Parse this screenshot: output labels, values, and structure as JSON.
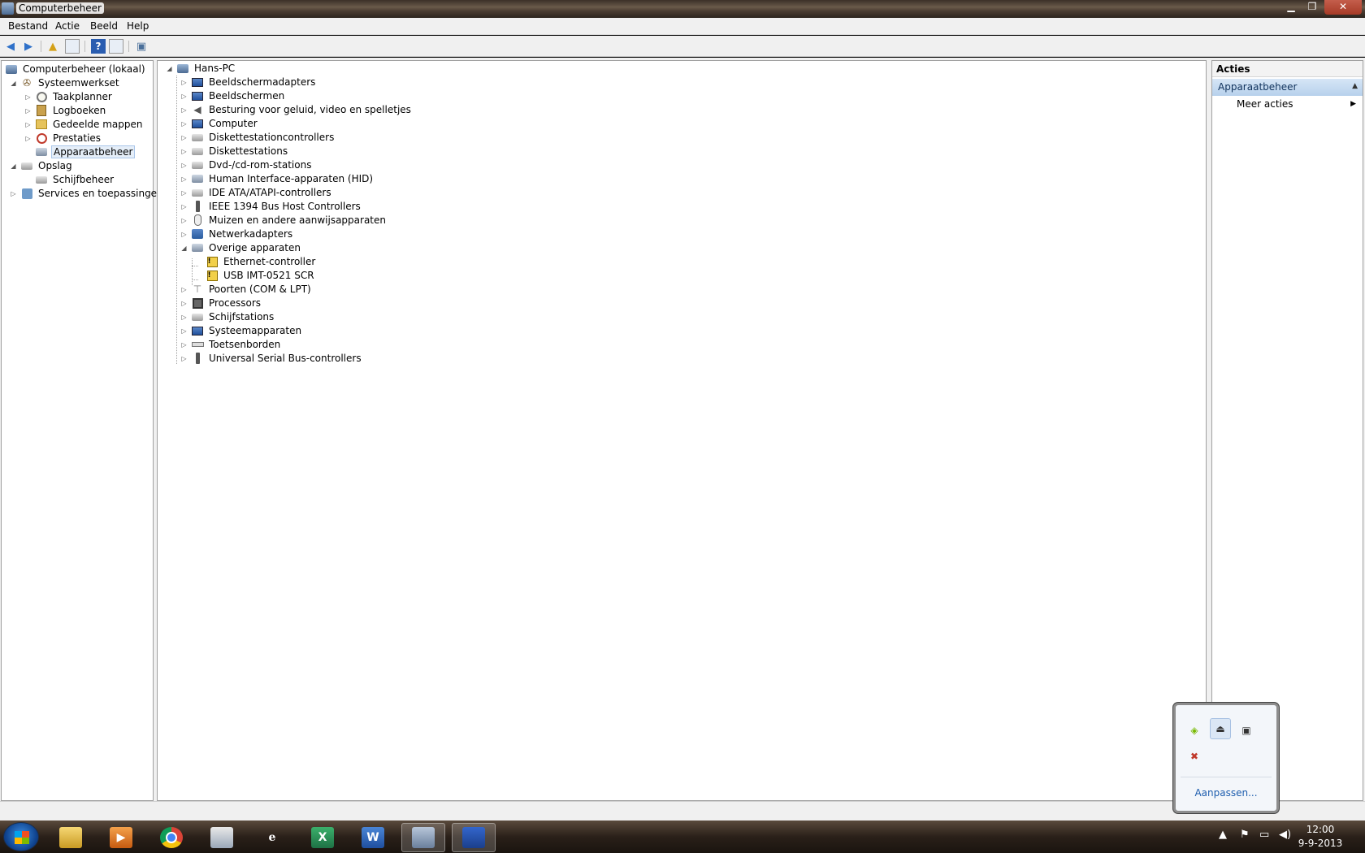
{
  "window": {
    "title": "Computerbeheer",
    "controls": {
      "minimize": "▁",
      "maximize": "❐",
      "close": "✕"
    }
  },
  "menu": [
    "Bestand",
    "Actie",
    "Beeld",
    "Help"
  ],
  "toolbar": [
    "back-icon",
    "forward-icon",
    "up-icon",
    "show-hide-tree-icon",
    "help-icon",
    "show-hide-action-icon",
    "properties-icon"
  ],
  "tree": {
    "root": "Computerbeheer (lokaal)",
    "systeemwerkset": "Systeemwerkset",
    "taakplanner": "Taakplanner",
    "logboeken": "Logboeken",
    "gedeelde_mappen": "Gedeelde mappen",
    "prestaties": "Prestaties",
    "apparaatbeheer": "Apparaatbeheer",
    "opslag": "Opslag",
    "schijfbeheer": "Schijfbeheer",
    "services": "Services en toepassingen"
  },
  "devices": {
    "root": "Hans-PC",
    "categories": [
      "Beeldschermadapters",
      "Beeldschermen",
      "Besturing voor geluid, video en spelletjes",
      "Computer",
      "Diskettestationcontrollers",
      "Diskettestations",
      "Dvd-/cd-rom-stations",
      "Human Interface-apparaten (HID)",
      "IDE ATA/ATAPI-controllers",
      "IEEE 1394 Bus Host Controllers",
      "Muizen en andere aanwijsapparaten",
      "Netwerkadapters",
      "Overige apparaten",
      "Poorten (COM & LPT)",
      "Processors",
      "Schijfstations",
      "Systeemapparaten",
      "Toetsenborden",
      "Universal Serial Bus-controllers"
    ],
    "other_children": [
      "Ethernet-controller",
      "USB IMT-0521 SCR"
    ]
  },
  "actions": {
    "header": "Acties",
    "section": "Apparaatbeheer",
    "item": "Meer acties"
  },
  "tray_popup": {
    "link": "Aanpassen...",
    "icons": [
      "nvidia-icon",
      "usb-device-icon",
      "drive-icon",
      "red-flag-icon"
    ]
  },
  "taskbar": {
    "apps": [
      "windows-explorer",
      "media-player",
      "chrome",
      "mail",
      "internet-explorer",
      "excel",
      "word",
      "computerbeheer",
      "floppy-app"
    ],
    "clock_time": "12:00",
    "clock_date": "9-9-2013"
  }
}
